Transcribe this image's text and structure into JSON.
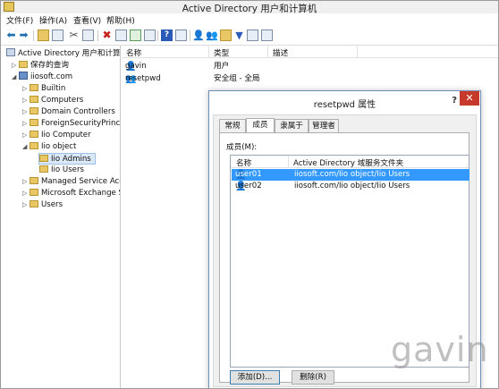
{
  "window": {
    "title": "Active Directory 用户和计算机"
  },
  "menu": [
    "文件(F)",
    "操作(A)",
    "查看(V)",
    "帮助(H)"
  ],
  "toolbar": [
    {
      "name": "back-arrow-icon",
      "glyph": "⬅"
    },
    {
      "name": "forward-arrow-icon",
      "glyph": "➡"
    },
    {
      "name": "up-folder-icon",
      "glyph": ""
    },
    {
      "name": "show-tree-icon",
      "glyph": ""
    },
    {
      "name": "cut-icon",
      "glyph": "✂"
    },
    {
      "name": "copy-icon",
      "glyph": ""
    },
    {
      "name": "delete-icon",
      "glyph": "✖"
    },
    {
      "name": "properties-icon",
      "glyph": ""
    },
    {
      "name": "refresh-icon",
      "glyph": ""
    },
    {
      "name": "export-list-icon",
      "glyph": ""
    },
    {
      "name": "help-icon",
      "glyph": "?"
    },
    {
      "name": "view-icon",
      "glyph": ""
    },
    {
      "name": "new-user-icon",
      "glyph": "👤"
    },
    {
      "name": "new-group-icon",
      "glyph": "👥"
    },
    {
      "name": "new-ou-icon",
      "glyph": ""
    },
    {
      "name": "filter-icon",
      "glyph": "▼"
    },
    {
      "name": "find-icon",
      "glyph": ""
    },
    {
      "name": "add-to-group-icon",
      "glyph": ""
    }
  ],
  "tree": {
    "items": [
      {
        "label": "Active Directory 用户和计算机",
        "level": 0,
        "expand": "",
        "icon": "ad"
      },
      {
        "label": "保存的查询",
        "level": 1,
        "expand": "▷",
        "icon": "folder"
      },
      {
        "label": "iiosoft.com",
        "level": 1,
        "expand": "◢",
        "icon": "domain"
      },
      {
        "label": "Builtin",
        "level": 2,
        "expand": "▷",
        "icon": "folder"
      },
      {
        "label": "Computers",
        "level": 2,
        "expand": "▷",
        "icon": "folder"
      },
      {
        "label": "Domain Controllers",
        "level": 2,
        "expand": "▷",
        "icon": "folder"
      },
      {
        "label": "ForeignSecurityPrincipa",
        "level": 2,
        "expand": "▷",
        "icon": "folder"
      },
      {
        "label": "Iio Computer",
        "level": 2,
        "expand": "▷",
        "icon": "folder"
      },
      {
        "label": "Iio object",
        "level": 2,
        "expand": "◢",
        "icon": "folder"
      },
      {
        "label": "Iio Admins",
        "level": 3,
        "expand": "",
        "icon": "folder",
        "selected": true
      },
      {
        "label": "Iio Users",
        "level": 3,
        "expand": "",
        "icon": "folder"
      },
      {
        "label": "Managed Service Acco",
        "level": 2,
        "expand": "▷",
        "icon": "folder"
      },
      {
        "label": "Microsoft Exchange Se",
        "level": 2,
        "expand": "▷",
        "icon": "folder"
      },
      {
        "label": "Users",
        "level": 2,
        "expand": "▷",
        "icon": "folder"
      }
    ]
  },
  "list": {
    "columns": [
      "名称",
      "类型",
      "描述"
    ],
    "rows": [
      {
        "name": "gavin",
        "type": "用户",
        "desc": "",
        "icon": "user"
      },
      {
        "name": "resetpwd",
        "type": "安全组 - 全局",
        "desc": "",
        "icon": "group"
      }
    ]
  },
  "dialog": {
    "title": "resetpwd 属性",
    "help": "?",
    "close": "✕",
    "tabs": [
      "常规",
      "成员",
      "隶属于",
      "管理者"
    ],
    "active_tab": "成员",
    "members_label": "成员(M):",
    "columns": [
      "名称",
      "Active Directory 域服务文件夹"
    ],
    "rows": [
      {
        "name": "user01",
        "folder": "iiosoft.com/Iio object/Iio Users",
        "selected": true
      },
      {
        "name": "user02",
        "folder": "iiosoft.com/Iio object/Iio Users",
        "selected": false
      }
    ],
    "add_button": "添加(D)...",
    "remove_button": "删除(R)"
  },
  "watermark": "gavin"
}
